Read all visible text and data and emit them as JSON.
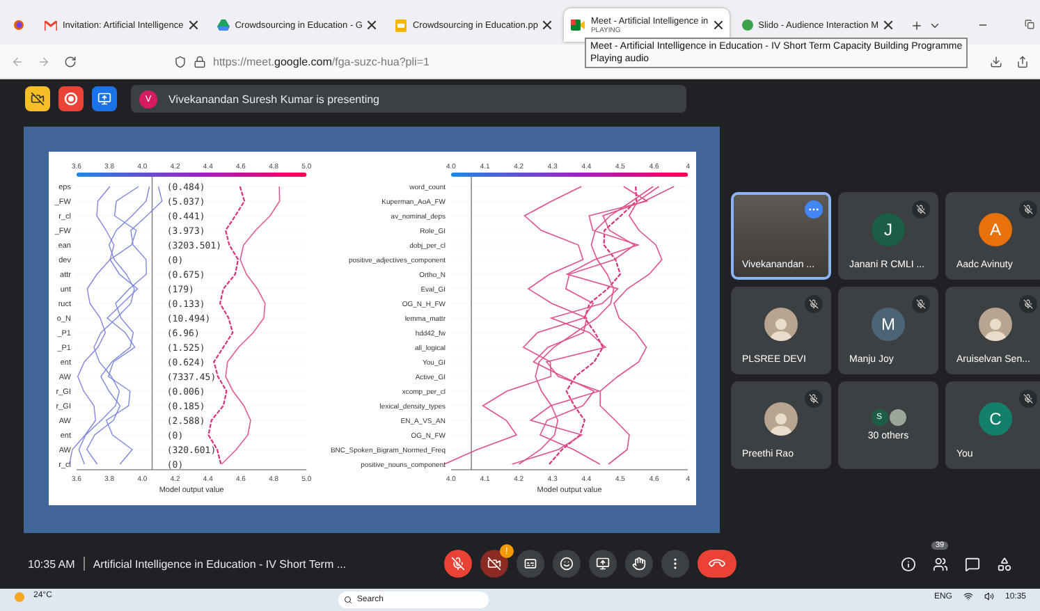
{
  "browser": {
    "tabs": [
      {
        "kind": "mail",
        "title": "Invitation: Artificial Intelligence",
        "selected": false
      },
      {
        "kind": "drive",
        "title": "Crowdsourcing in Education - G",
        "selected": false
      },
      {
        "kind": "slides",
        "title": "Crowdsourcing in Education.pp",
        "selected": false
      },
      {
        "kind": "meet",
        "title": "Meet - Artificial Intelligence in",
        "subtitle": "PLAYING",
        "selected": true
      },
      {
        "kind": "slido",
        "title": "Slido - Audience Interaction M",
        "selected": false
      }
    ],
    "url": "https://meet.**google.com**/fga-suzc-hua?pli=1",
    "tooltip": {
      "title": "Meet - Artificial Intelligence in Education - IV Short Term Capacity Building Programme",
      "status": "Playing audio"
    }
  },
  "meet": {
    "presenter": {
      "initial": "V",
      "text": "Vivekanandan Suresh Kumar is presenting"
    },
    "left_plot": {
      "ticks": [
        "3.6",
        "3.8",
        "4.0",
        "4.2",
        "4.4",
        "4.6",
        "4.8",
        "5.0"
      ],
      "bottom_ticks": [
        "3.6",
        "3.8",
        "4.0",
        "4.2",
        "4.4",
        "4.6",
        "4.8",
        "5.0"
      ],
      "features": [
        "eps",
        "_FW",
        "r_cl",
        "_FW",
        "ean",
        "dev",
        "attr",
        "unt",
        "ruct",
        "o_N",
        "_P1",
        "_P1",
        "ent",
        "AW",
        "r_GI",
        "r_GI",
        "AW",
        "ent",
        "AW",
        "r_cl"
      ],
      "values": [
        "(0.484)",
        "(5.037)",
        "(0.441)",
        "(3.973)",
        "(3203.501)",
        "(0)",
        "(0.675)",
        "(179)",
        "(0.133)",
        "(10.494)",
        "(6.96)",
        "(1.525)",
        "(0.624)",
        "(7337.45)",
        "(0.006)",
        "(0.185)",
        "(2.588)",
        "(0)",
        "(320.601)",
        "(0)"
      ],
      "xlabel": "Model output value"
    },
    "right_plot": {
      "ticks": [
        "4.0",
        "4.1",
        "4.2",
        "4.3",
        "4.4",
        "4.5",
        "4.6",
        "4"
      ],
      "bottom_ticks": [
        "4.0",
        "4.1",
        "4.2",
        "4.3",
        "4.4",
        "4.5",
        "4.6",
        "4"
      ],
      "features": [
        "word_count",
        "Kuperman_AoA_FW",
        "av_nominal_deps",
        "Role_GI",
        "dobj_per_cl",
        "positive_adjectives_component",
        "Ortho_N",
        "Eval_GI",
        "OG_N_H_FW",
        "lemma_mattr",
        "hdd42_fw",
        "all_logical",
        "You_GI",
        "Active_GI",
        "xcomp_per_cl",
        "lexical_density_types",
        "EN_A_VS_AN",
        "OG_N_FW",
        "BNC_Spoken_Bigram_Normed_Freq",
        "positive_nouns_component"
      ],
      "xlabel": "Model output value"
    },
    "participants": [
      {
        "kind": "video",
        "name": "Vivekanandan ...",
        "muted": false,
        "highlighted": true
      },
      {
        "kind": "initial",
        "name": "Janani R CMLI ...",
        "initial": "J",
        "color": "#1b5e45",
        "muted": true,
        "highlighted": false
      },
      {
        "kind": "initial",
        "name": "Aadc Avinuty",
        "initial": "A",
        "color": "#e8710a",
        "muted": true,
        "highlighted": false
      },
      {
        "kind": "photo",
        "name": "PLSREE DEVI",
        "muted": true,
        "highlighted": false
      },
      {
        "kind": "initial",
        "name": "Manju Joy",
        "initial": "M",
        "color": "#4b6576",
        "muted": true,
        "highlighted": false
      },
      {
        "kind": "photo",
        "name": "Aruiselvan Sen...",
        "muted": true,
        "highlighted": false
      },
      {
        "kind": "photo",
        "name": "Preethi Rao",
        "muted": true,
        "highlighted": false
      },
      {
        "kind": "others",
        "name": "30 others",
        "initial": "S",
        "color": "#1b5e45",
        "muted": false,
        "highlighted": false
      },
      {
        "kind": "initial",
        "name": "You",
        "initial": "C",
        "color": "#12806a",
        "muted": true,
        "highlighted": false
      }
    ],
    "time": "10:35 AM",
    "meeting_title": "Artificial Intelligence in Education - IV Short Term ...",
    "controls": {
      "mic_muted": true,
      "camera_off": true,
      "camera_alert": "!"
    },
    "participant_count": "39"
  },
  "taskbar": {
    "weather": "24°C",
    "search_placeholder": "Search",
    "language": "ENG",
    "clock": "10:35"
  }
}
